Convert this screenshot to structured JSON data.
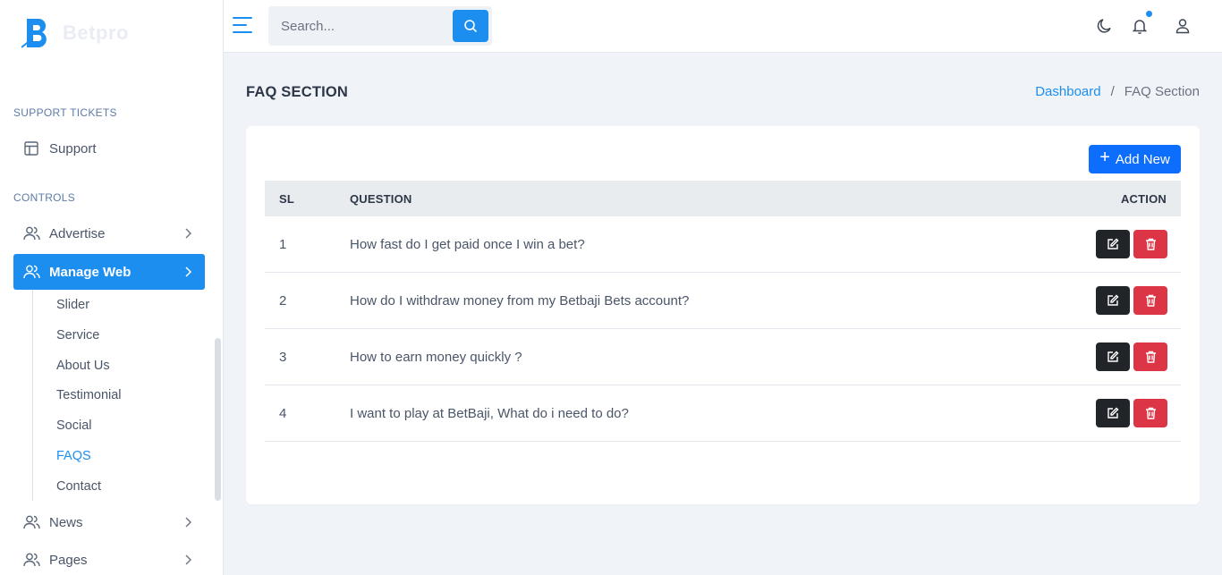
{
  "brand": {
    "name": "Betpro",
    "accent": "#1c8ef0"
  },
  "sidebar": {
    "sections": [
      {
        "title": "SUPPORT TICKETS"
      },
      {
        "title": "CONTROLS"
      }
    ],
    "items": [
      {
        "label": "Support",
        "icon": "table-icon"
      },
      {
        "label": "Advertise",
        "icon": "users-icon"
      },
      {
        "label": "Manage Web",
        "icon": "users-icon"
      },
      {
        "label": "News",
        "icon": "users-icon"
      },
      {
        "label": "Pages",
        "icon": "users-icon"
      }
    ],
    "submenu": [
      "Slider",
      "Service",
      "About Us",
      "Testimonial",
      "Social",
      "FAQS",
      "Contact"
    ]
  },
  "topbar": {
    "search_placeholder": "Search...",
    "icons": [
      "menu-icon",
      "search-icon",
      "moon-icon",
      "bell-icon",
      "user-icon"
    ]
  },
  "page": {
    "title": "FAQ SECTION",
    "breadcrumb": {
      "link": "Dashboard",
      "separator": "/",
      "current": "FAQ Section"
    }
  },
  "card": {
    "add_label": "Add New",
    "columns": {
      "sl": "SL",
      "question": "QUESTION",
      "action": "ACTION"
    },
    "rows": [
      {
        "sl": "1",
        "question": "How fast do I get paid once I win a bet?"
      },
      {
        "sl": "2",
        "question": "How do I withdraw money from my Betbaji Bets account?"
      },
      {
        "sl": "3",
        "question": "How to earn money quickly ?"
      },
      {
        "sl": "4",
        "question": "I want to play at BetBaji, What do i need to do?"
      }
    ]
  },
  "colors": {
    "primary": "#0d6efd",
    "edit": "#212529",
    "delete": "#dc3545"
  }
}
